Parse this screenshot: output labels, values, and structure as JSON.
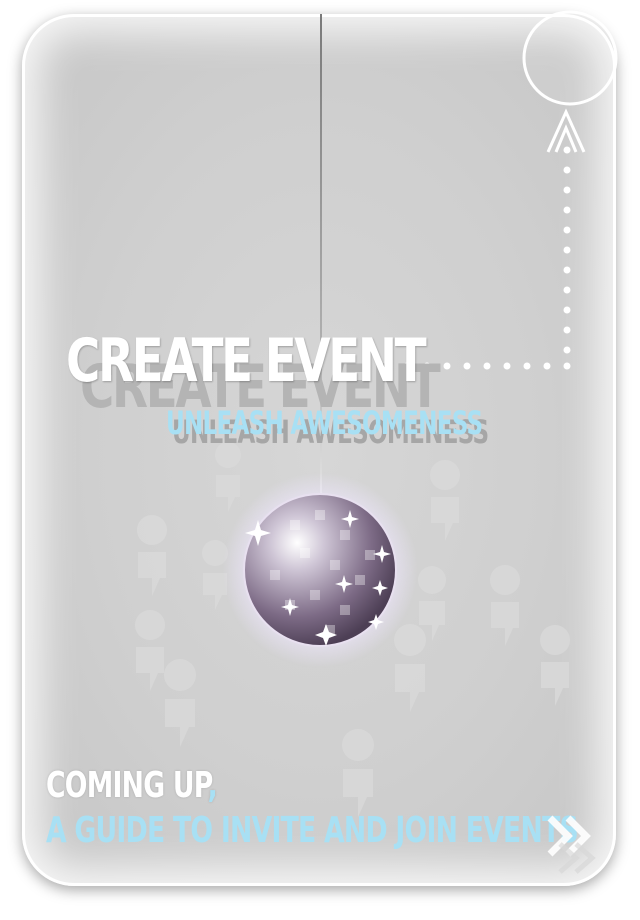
{
  "hero": {
    "title": "CREATE EVENT",
    "subtitle": "UNLEASH AWESOMENESS"
  },
  "footer": {
    "coming_up": "COMING UP",
    "coming_up_comma": ",",
    "guide_link": "A GUIDE TO INVITE AND JOIN EVENTS"
  },
  "icons": {
    "next": "double-chevron-right-icon",
    "top_right": "circle-button-with-up-arrow-icon",
    "disco": "disco-ball-icon",
    "people": "people-silhouettes"
  },
  "colors": {
    "background": "#cfcfcf",
    "accent_blue": "#a8e0f4",
    "text_white": "#ffffff"
  }
}
